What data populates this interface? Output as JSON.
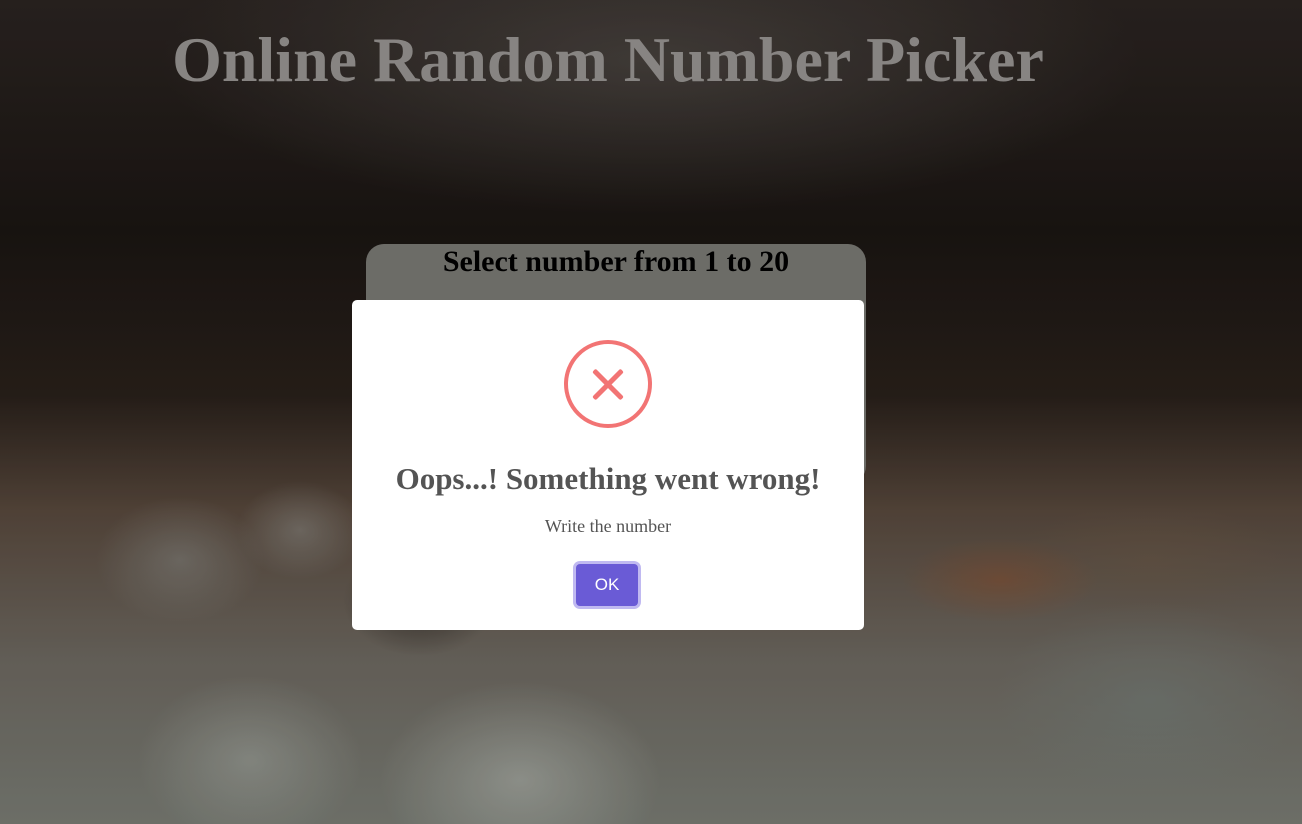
{
  "page": {
    "title": "Online Random Number Picker"
  },
  "picker": {
    "heading": "Select number from 1 to 20"
  },
  "dialog": {
    "icon": "error-x-icon",
    "title": "Oops...! Something went wrong!",
    "message": "Write the number",
    "ok_label": "OK"
  },
  "colors": {
    "error_accent": "#f27474",
    "button": "#6a5bd6",
    "dialog_text": "#545454"
  }
}
